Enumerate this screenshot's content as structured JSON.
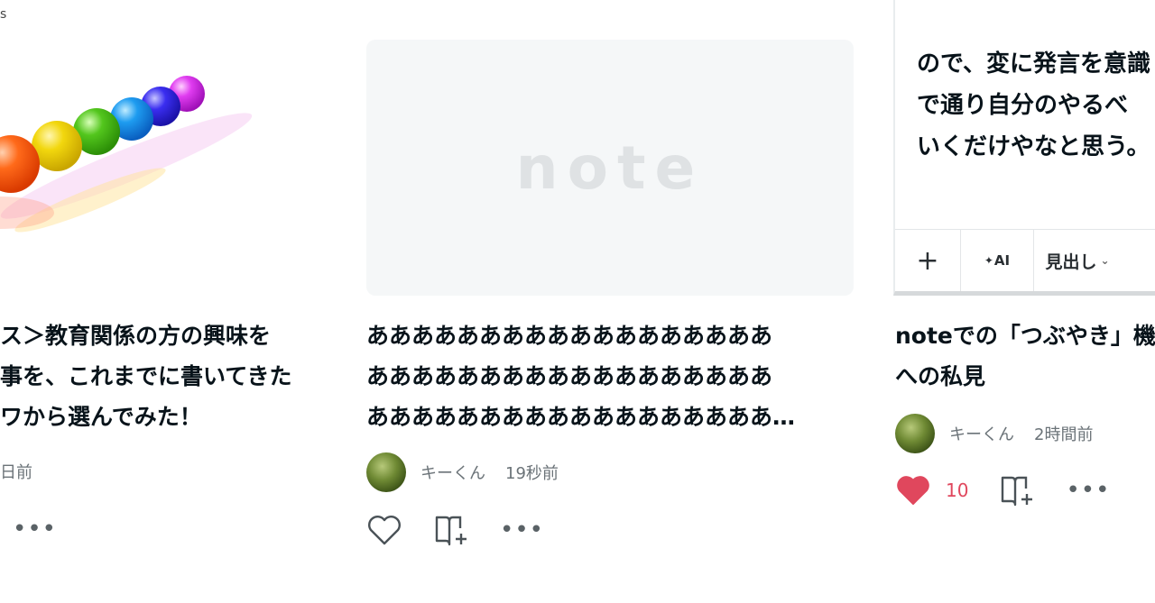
{
  "topleft_text": "s",
  "cards": [
    {
      "thumb_alt": "rainbow glass spheres",
      "title_lines": [
        "ス＞教育関係の方の興味を",
        "事を、これまでに書いてきた",
        "ワから選んでみた！"
      ],
      "time": "日前",
      "actions": {
        "more": "•••"
      }
    },
    {
      "thumb_logo": "note",
      "title_lines": [
        "ああああああああああああああああああ",
        "ああああああああああああああああああ",
        "ああああああああああああああああああ…"
      ],
      "author": "キーくん",
      "time": "19秒前",
      "actions": {
        "more": "•••"
      }
    },
    {
      "editor_lines": [
        "ので、変に発言を意識",
        "で通り自分のやるべ",
        "いくだけやなと思う。"
      ],
      "toolbar": {
        "plus": "+",
        "ai": "AI",
        "heading": "見出し"
      },
      "title_lines": [
        "noteでの「つぶやき」機",
        "への私見"
      ],
      "author": "キーくん",
      "time": "2時間前",
      "likes": "10",
      "actions": {
        "more": "•••"
      }
    }
  ],
  "colors": {
    "like": "#e0475d",
    "placeholder_bg": "#f5f7f8",
    "logo": "#dfe2e4"
  }
}
